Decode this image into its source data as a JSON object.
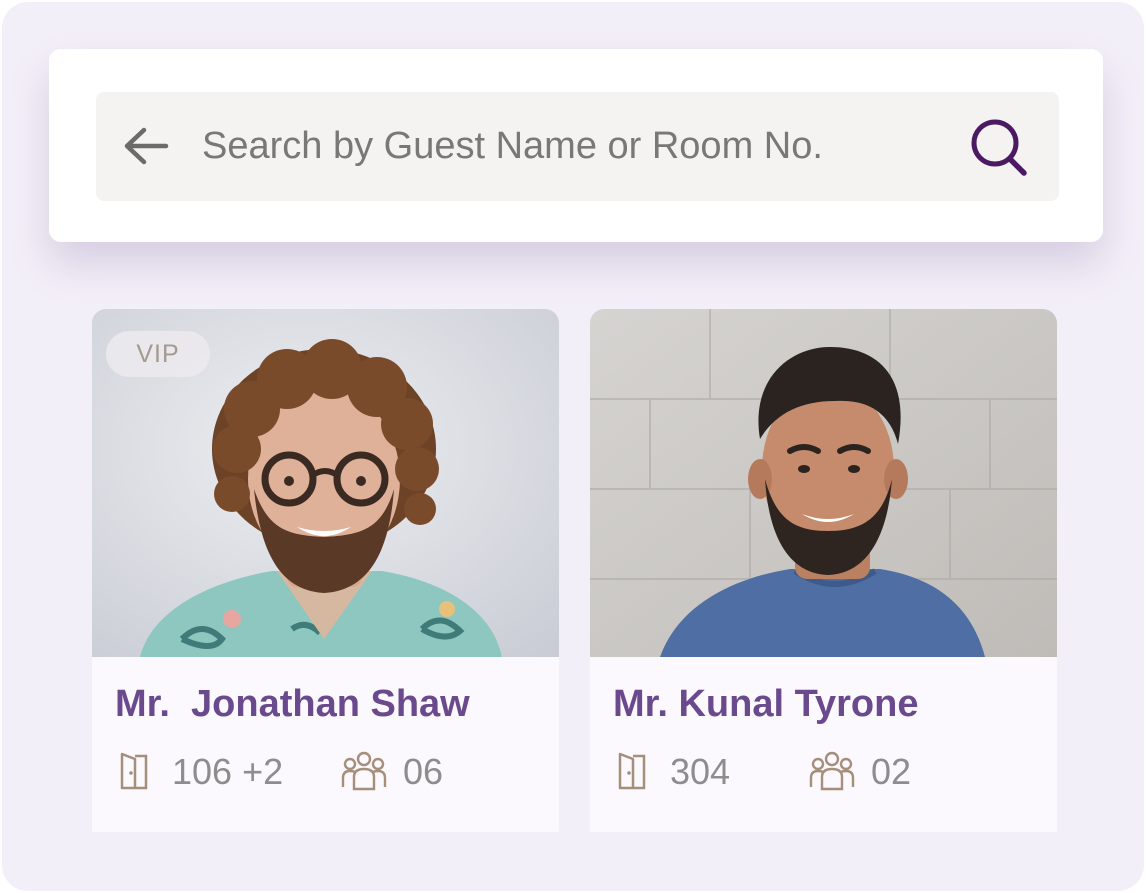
{
  "search": {
    "placeholder": "Search by Guest Name or Room No.",
    "back_icon": "arrow-left-icon",
    "search_icon": "magnifier-icon",
    "accent_color": "#4b1a63"
  },
  "guests": [
    {
      "badge": "VIP",
      "name": "Mr.  Jonathan Shaw",
      "room": "106 +2",
      "guests_count": "06",
      "room_icon": "door-icon",
      "people_icon": "people-group-icon"
    },
    {
      "name": "Mr. Kunal Tyrone",
      "room": "304",
      "guests_count": "02",
      "room_icon": "door-icon",
      "people_icon": "people-group-icon"
    }
  ],
  "colors": {
    "name_text": "#6a4a8c",
    "meta_text": "#8d8d8d",
    "icon_tan": "#a58e7a",
    "frame_bg": "#f3eff8"
  }
}
